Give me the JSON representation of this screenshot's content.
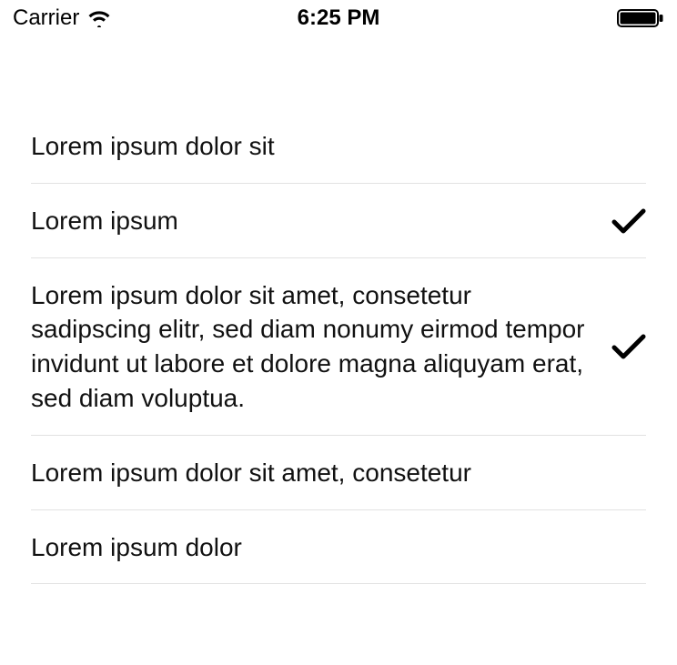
{
  "status_bar": {
    "carrier": "Carrier",
    "time": "6:25 PM"
  },
  "list": {
    "items": [
      {
        "label": "Lorem ipsum dolor sit",
        "checked": false
      },
      {
        "label": "Lorem ipsum",
        "checked": true
      },
      {
        "label": "Lorem ipsum dolor sit amet, consetetur sadipscing elitr, sed diam nonumy eirmod tempor invidunt ut labore et dolore magna aliquyam erat, sed diam voluptua.",
        "checked": true
      },
      {
        "label": "Lorem ipsum dolor sit amet, consetetur",
        "checked": false
      },
      {
        "label": "Lorem ipsum dolor",
        "checked": false
      }
    ]
  }
}
